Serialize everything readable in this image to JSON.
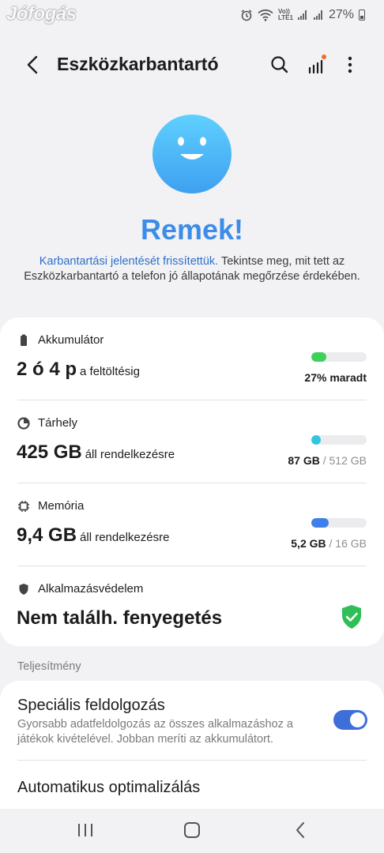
{
  "status_bar": {
    "watermark": "Jófogás",
    "volte_label": "Vo)) LTE1",
    "battery_percent": "27%",
    "icons": [
      "alarm-icon",
      "wifi-icon",
      "volte-icon",
      "signal-icon",
      "signal-icon",
      "battery-icon"
    ]
  },
  "appbar": {
    "title": "Eszközkarbantartó",
    "icons": [
      "back-arrow-icon",
      "search-icon",
      "signal-bars-icon",
      "more-vertical-icon"
    ],
    "notification_dot_color": "#f26b2a"
  },
  "hero": {
    "status": "Remek!",
    "description_link": "Karbantartási jelentését frissítettük.",
    "description_rest": " Tekintse meg, mit tett az Eszközkarbantartó a telefon jó állapotának megőrzése érdekében."
  },
  "items": {
    "battery": {
      "label": "Akkumulátor",
      "value": "2 ó 4 p",
      "suffix": "a feltöltésig",
      "bar_level": 0.27,
      "bar_color": "#3ed15a",
      "status": "27% maradt"
    },
    "storage": {
      "label": "Tárhely",
      "value": "425 GB",
      "suffix": "áll rendelkezésre",
      "bar_level": 0.17,
      "bar_color": "#2ec6e0",
      "used": "87 GB",
      "separator": " / ",
      "total": "512 GB"
    },
    "memory": {
      "label": "Memória",
      "value": "9,4 GB",
      "suffix": "áll rendelkezésre",
      "bar_level": 0.32,
      "bar_color": "#3e7fe8",
      "used": "5,2 GB",
      "separator": " / ",
      "total": "16 GB"
    },
    "protection": {
      "label": "Alkalmazásvédelem",
      "value": "Nem találh. fenyegetés",
      "shield_color": "#2fbf56"
    }
  },
  "performance": {
    "section_label": "Teljesítmény",
    "special_title": "Speciális feldolgozás",
    "special_desc": "Gyorsabb adatfeldolgozás az összes alkalmazáshoz a játékok kivételével. Jobban meríti az akkumulátort.",
    "special_enabled": true,
    "auto_title": "Automatikus optimalizálás"
  },
  "navbar": {
    "icons": [
      "recent-apps-icon",
      "home-icon",
      "back-icon"
    ]
  }
}
